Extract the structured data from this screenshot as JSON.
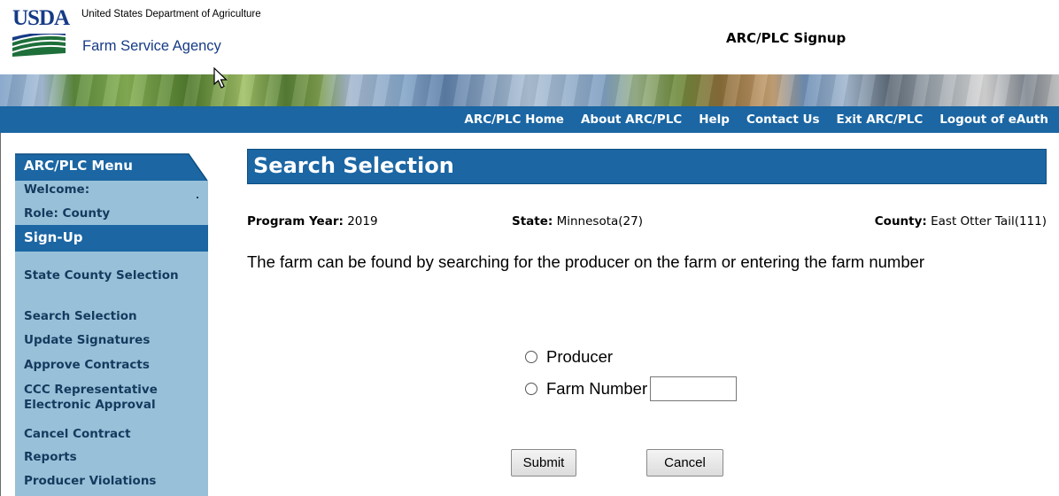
{
  "header": {
    "logo_text": "USDA",
    "department": "United States Department of Agriculture",
    "agency": "Farm Service Agency",
    "app_title": "ARC/PLC Signup"
  },
  "nav": {
    "links": [
      "ARC/PLC Home",
      "About ARC/PLC",
      "Help",
      "Contact Us",
      "Exit ARC/PLC",
      "Logout of eAuth"
    ]
  },
  "sidebar": {
    "menu_title": "ARC/PLC Menu",
    "welcome": "Welcome:",
    "role": "Role: County",
    "section_title": "Sign-Up",
    "items": [
      "State County Selection",
      "Search Selection",
      "Update Signatures",
      "Approve Contracts",
      "CCC Representative Electronic Approval",
      "Cancel Contract",
      "Reports",
      "Producer Violations"
    ]
  },
  "main": {
    "heading": "Search Selection",
    "program_year_label": "Program Year:",
    "program_year_value": "2019",
    "state_label": "State:",
    "state_value": "Minnesota(27)",
    "county_label": "County:",
    "county_value": "East Otter Tail(111)",
    "instructions": "The farm can be found by searching for the producer on the farm or entering the farm number",
    "options": {
      "producer": "Producer",
      "farm_number": "Farm Number"
    },
    "farm_number_value": "",
    "submit_label": "Submit",
    "cancel_label": "Cancel"
  },
  "colors": {
    "nav_blue": "#1b66a3",
    "sidebar_bg": "#98c1d9",
    "sidebar_text": "#163a5e",
    "agency_blue": "#163b86"
  }
}
